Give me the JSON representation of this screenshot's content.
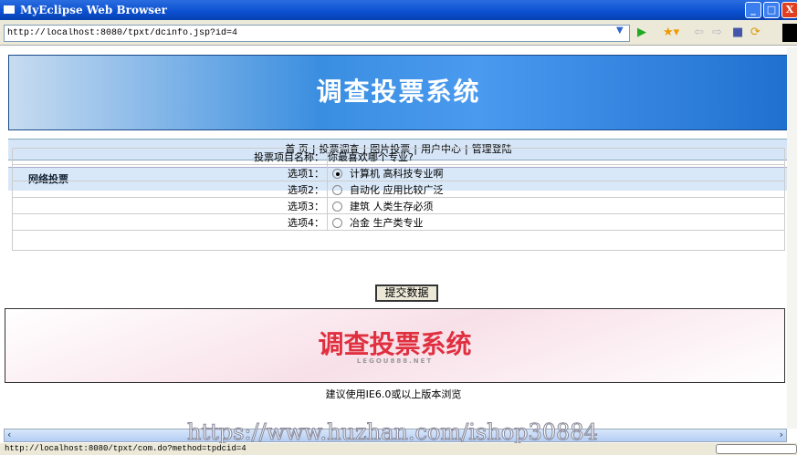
{
  "window": {
    "title": "MyEclipse Web Browser"
  },
  "address": {
    "url": "http://localhost:8080/tpxt/dcinfo.jsp?id=4"
  },
  "banner": {
    "title": "调查投票系统"
  },
  "nav": [
    "首 页",
    "投票调查",
    "图片投票",
    "用户中心",
    "管理登陆"
  ],
  "section": {
    "title": "网络投票"
  },
  "vote": {
    "name_label": "投票项目名称：",
    "name_value": "你最喜欢哪个专业?",
    "options": [
      {
        "label": "选项1：",
        "text": "计算机 高科技专业啊",
        "selected": true
      },
      {
        "label": "选项2：",
        "text": "自动化 应用比较广泛",
        "selected": false
      },
      {
        "label": "选项3：",
        "text": "建筑 人类生存必须",
        "selected": false
      },
      {
        "label": "选项4：",
        "text": "冶金 生产类专业",
        "selected": false
      }
    ],
    "submit": "提交数据"
  },
  "footer": {
    "banner_title": "调查投票系统",
    "banner_sub": "LEGOU888.NET",
    "text": "建议使用IE6.0或以上版本浏览"
  },
  "watermark": "https://www.huzhan.com/ishop30884",
  "status": {
    "text": "http://localhost:8080/tpxt/com.do?method=tpdcid=4"
  }
}
